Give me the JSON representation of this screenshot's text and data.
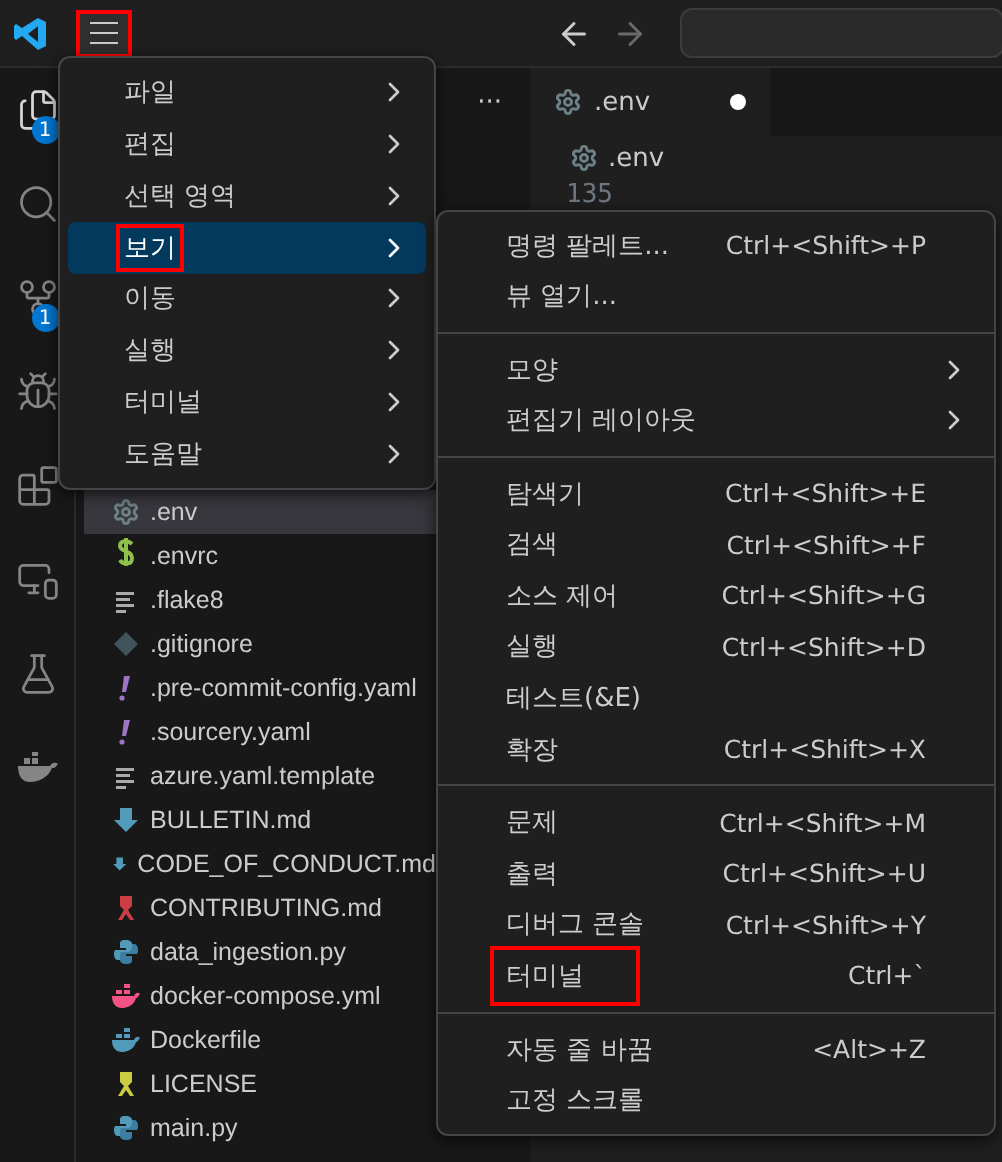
{
  "title_bar": {
    "menu_button": {
      "annotated": true
    }
  },
  "activity_bar": [
    {
      "kind": "files",
      "badge": "1"
    },
    {
      "kind": "search"
    },
    {
      "kind": "git",
      "badge": "1"
    },
    {
      "kind": "debug"
    },
    {
      "kind": "extensions"
    },
    {
      "kind": "remote"
    },
    {
      "kind": "flask"
    },
    {
      "kind": "docker"
    }
  ],
  "sidebar": {
    "more": "···",
    "files": [
      {
        "name": ".env",
        "kind": "gear",
        "selected": true
      },
      {
        "name": ".envrc",
        "kind": "dollar",
        "selected": false
      },
      {
        "name": ".flake8",
        "kind": "lines",
        "selected": false
      },
      {
        "name": ".gitignore",
        "kind": "diamond",
        "selected": false
      },
      {
        "name": ".pre-commit-config.yaml",
        "kind": "bang",
        "selected": false
      },
      {
        "name": ".sourcery.yaml",
        "kind": "bang",
        "selected": false
      },
      {
        "name": "azure.yaml.template",
        "kind": "lines",
        "selected": false
      },
      {
        "name": "BULLETIN.md",
        "kind": "down",
        "selected": false
      },
      {
        "name": "CODE_OF_CONDUCT.md",
        "kind": "down",
        "selected": false
      },
      {
        "name": "CONTRIBUTING.md",
        "kind": "ribbon",
        "selected": false
      },
      {
        "name": "data_ingestion.py",
        "kind": "python",
        "selected": false
      },
      {
        "name": "docker-compose.yml",
        "kind": "compose",
        "selected": false
      },
      {
        "name": "Dockerfile",
        "kind": "docker",
        "selected": false
      },
      {
        "name": "LICENSE",
        "kind": "license",
        "selected": false
      },
      {
        "name": "main.py",
        "kind": "python",
        "selected": false
      }
    ]
  },
  "editor": {
    "tab": {
      "label": ".env",
      "modified": true
    },
    "breadcrumb": ".env",
    "line_number": "135"
  },
  "main_menu": [
    {
      "label": "파일",
      "selected": false,
      "annotated": false
    },
    {
      "label": "편집",
      "selected": false,
      "annotated": false
    },
    {
      "label": "선택 영역",
      "selected": false,
      "annotated": false
    },
    {
      "label": "보기",
      "selected": true,
      "annotated": true
    },
    {
      "label": "이동",
      "selected": false,
      "annotated": false
    },
    {
      "label": "실행",
      "selected": false,
      "annotated": false
    },
    {
      "label": "터미널",
      "selected": false,
      "annotated": false
    },
    {
      "label": "도움말",
      "selected": false,
      "annotated": false
    }
  ],
  "view_submenu": [
    {
      "kind": "item",
      "label": "명령 팔레트...",
      "shortcut": "Ctrl+<Shift>+P",
      "annotated": false
    },
    {
      "kind": "item",
      "label": "뷰 열기...",
      "annotated": false
    },
    {
      "kind": "separator"
    },
    {
      "kind": "submenu",
      "label": "모양",
      "annotated": false
    },
    {
      "kind": "submenu",
      "label": "편집기 레이아웃",
      "annotated": false
    },
    {
      "kind": "separator"
    },
    {
      "kind": "item",
      "label": "탐색기",
      "shortcut": "Ctrl+<Shift>+E",
      "annotated": false
    },
    {
      "kind": "item",
      "label": "검색",
      "shortcut": "Ctrl+<Shift>+F",
      "annotated": false
    },
    {
      "kind": "item",
      "label": "소스 제어",
      "shortcut": "Ctrl+<Shift>+G",
      "annotated": false
    },
    {
      "kind": "item",
      "label": "실행",
      "shortcut": "Ctrl+<Shift>+D",
      "annotated": false
    },
    {
      "kind": "item",
      "label": "테스트(&E)",
      "annotated": false
    },
    {
      "kind": "item",
      "label": "확장",
      "shortcut": "Ctrl+<Shift>+X",
      "annotated": false
    },
    {
      "kind": "separator"
    },
    {
      "kind": "item",
      "label": "문제",
      "shortcut": "Ctrl+<Shift>+M",
      "annotated": false
    },
    {
      "kind": "item",
      "label": "출력",
      "shortcut": "Ctrl+<Shift>+U",
      "annotated": false
    },
    {
      "kind": "item",
      "label": "디버그 콘솔",
      "shortcut": "Ctrl+<Shift>+Y",
      "annotated": false
    },
    {
      "kind": "item",
      "label": "터미널",
      "shortcut": "Ctrl+`",
      "annotated": true
    },
    {
      "kind": "separator"
    },
    {
      "kind": "item",
      "label": "자동 줄 바꿈",
      "shortcut": "<Alt>+Z",
      "annotated": false
    },
    {
      "kind": "item",
      "label": "고정 스크롤",
      "annotated": false
    }
  ]
}
